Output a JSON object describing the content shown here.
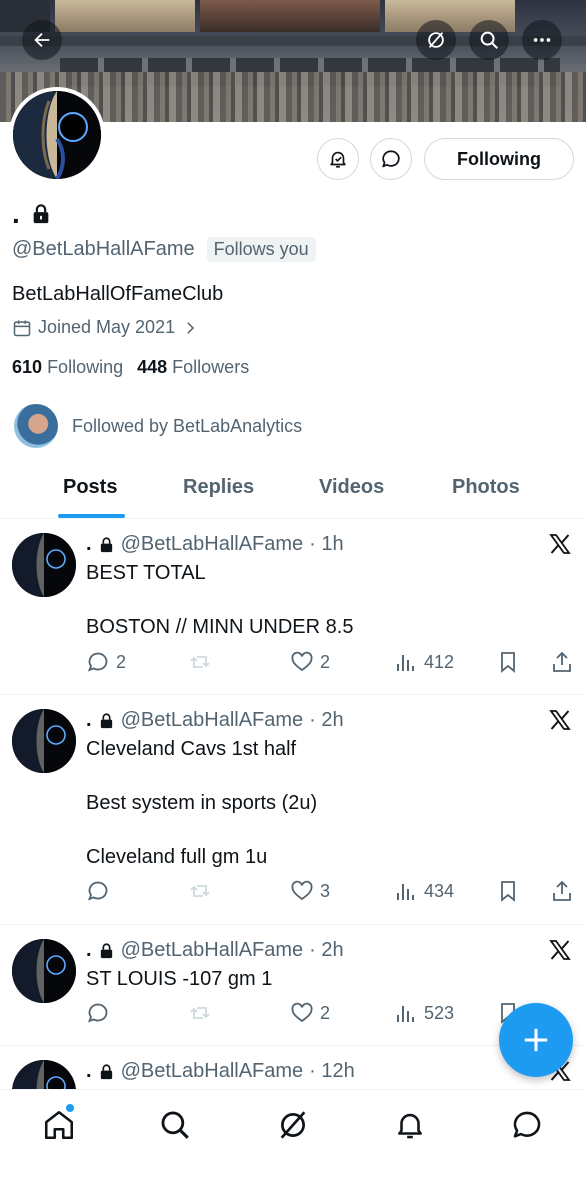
{
  "profile": {
    "display_name": ".",
    "handle": "@BetLabHallAFame",
    "follows_you": "Follows you",
    "bio": "BetLabHallOfFameClub",
    "joined": "Joined May 2021",
    "following_count": "610",
    "following_label": "Following",
    "followers_count": "448",
    "followers_label": "Followers",
    "followed_by": "Followed by BetLabAnalytics",
    "following_button": "Following"
  },
  "tabs": [
    "Posts",
    "Replies",
    "Videos",
    "Photos"
  ],
  "posts": [
    {
      "name": ".",
      "handle": "@BetLabHallAFame",
      "time": "· 1h",
      "text": "BEST TOTAL\n\nBOSTON // MINN UNDER 8.5",
      "replies": "2",
      "reposts": "",
      "likes": "2",
      "views": "412"
    },
    {
      "name": ".",
      "handle": "@BetLabHallAFame",
      "time": "· 2h",
      "text": "Cleveland Cavs 1st half\n\nBest system in sports (2u)\n\nCleveland full gm 1u",
      "replies": "",
      "reposts": "",
      "likes": "3",
      "views": "434"
    },
    {
      "name": ".",
      "handle": "@BetLabHallAFame",
      "time": "· 2h",
      "text": "ST LOUIS -107 gm 1",
      "replies": "",
      "reposts": "",
      "likes": "2",
      "views": "523"
    },
    {
      "name": ".",
      "handle": "@BetLabHallAFame",
      "time": "· 12h",
      "text": "",
      "replies": "",
      "reposts": "",
      "likes": "",
      "views": ""
    }
  ],
  "colors": {
    "accent": "#1d9bf0",
    "text": "#0f1419",
    "muted": "#536471",
    "border": "#eff3f4"
  },
  "icons": {
    "header": [
      "back-arrow-icon",
      "grok-icon",
      "search-icon",
      "more-icon"
    ],
    "profile_actions": [
      "notification-bell-icon",
      "message-icon"
    ],
    "bottom_nav": [
      "home-icon",
      "search-icon",
      "grok-icon",
      "notifications-icon",
      "messages-icon"
    ]
  }
}
